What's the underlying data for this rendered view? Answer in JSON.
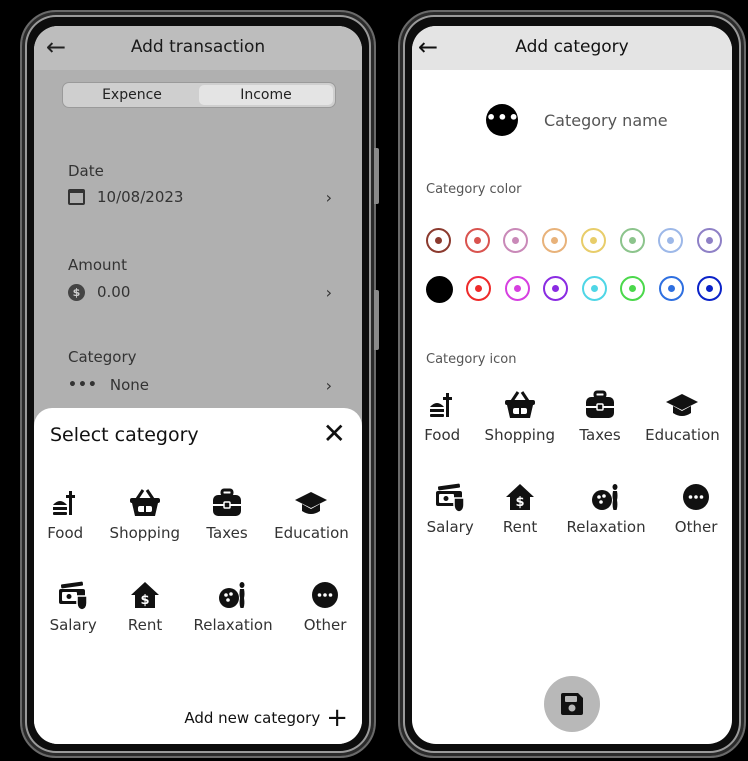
{
  "left_screen": {
    "header": {
      "title": "Add transaction",
      "back_icon": "arrow-left-icon"
    },
    "tabs": [
      {
        "label": "Expence",
        "active": false
      },
      {
        "label": "Income",
        "active": true
      }
    ],
    "fields": {
      "date": {
        "label": "Date",
        "value": "10/08/2023",
        "icon": "calendar-icon"
      },
      "amount": {
        "label": "Amount",
        "value": "0.00",
        "icon": "dollar-icon"
      },
      "category": {
        "label": "Category",
        "value": "None",
        "icon": "dots-icon",
        "icon_text": "•••"
      }
    },
    "sheet": {
      "title": "Select category",
      "close_glyph": "✕",
      "categories": [
        {
          "label": "Food",
          "icon": "food-icon"
        },
        {
          "label": "Shopping",
          "icon": "basket-icon"
        },
        {
          "label": "Taxes",
          "icon": "briefcase-icon"
        },
        {
          "label": "Education",
          "icon": "graduation-cap-icon"
        },
        {
          "label": "Salary",
          "icon": "salary-icon"
        },
        {
          "label": "Rent",
          "icon": "house-dollar-icon"
        },
        {
          "label": "Relaxation",
          "icon": "bowling-icon"
        },
        {
          "label": "Other",
          "icon": "more-icon"
        }
      ],
      "add_new_label": "Add new category",
      "add_glyph": "+"
    }
  },
  "right_screen": {
    "header": {
      "title": "Add category",
      "back_icon": "arrow-left-icon"
    },
    "name_field": {
      "placeholder": "Category name",
      "icon_text": "•••"
    },
    "color_section_label": "Category color",
    "colors_row1": [
      "#8B3A2E",
      "#D9534F",
      "#C989B8",
      "#E8B27A",
      "#E8CD6A",
      "#8CC48C",
      "#9DB8E8",
      "#8E80C6"
    ],
    "colors_row2": [
      "#000000",
      "#EE2A2A",
      "#D63FE0",
      "#8A2BE2",
      "#4FD6E6",
      "#4BD84B",
      "#2E6FE0",
      "#0A22C8"
    ],
    "icon_section_label": "Category icon",
    "categories": [
      {
        "label": "Food",
        "icon": "food-icon"
      },
      {
        "label": "Shopping",
        "icon": "basket-icon"
      },
      {
        "label": "Taxes",
        "icon": "briefcase-icon"
      },
      {
        "label": "Education",
        "icon": "graduation-cap-icon"
      },
      {
        "label": "Salary",
        "icon": "salary-icon"
      },
      {
        "label": "Rent",
        "icon": "house-dollar-icon"
      },
      {
        "label": "Relaxation",
        "icon": "bowling-icon"
      },
      {
        "label": "Other",
        "icon": "more-icon"
      }
    ],
    "save_icon": "floppy-disk-icon"
  }
}
